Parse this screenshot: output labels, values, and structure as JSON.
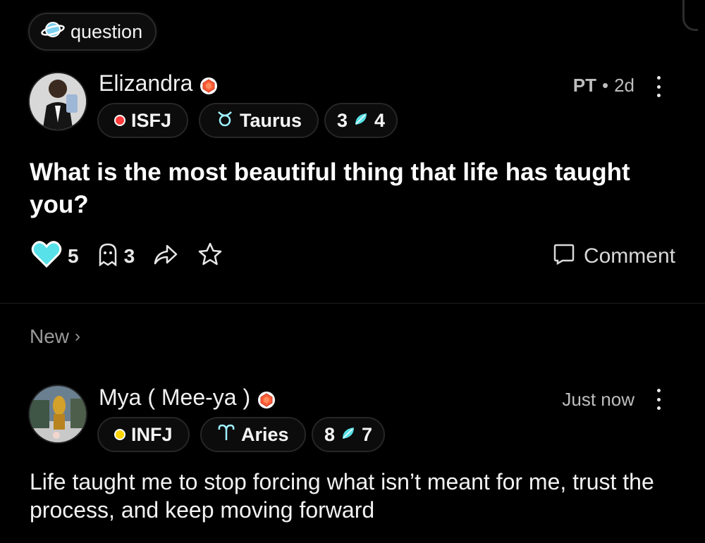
{
  "topic": {
    "label": "question",
    "icon": "planet-icon"
  },
  "post": {
    "author": {
      "name": "Elizandra",
      "mbti": "ISFJ",
      "mbti_color": "#ff3b3b",
      "zodiac": "Taurus",
      "zodiac_icon": "taurus-icon",
      "level_left": "3",
      "level_right": "4"
    },
    "meta": {
      "tag": "PT",
      "separator": "•",
      "time": "2d"
    },
    "title": "What is the most beautiful thing that life has taught you?",
    "likes": "5",
    "comments": "3",
    "comment_button": "Comment"
  },
  "section": {
    "label": "New",
    "chevron": "›"
  },
  "reply": {
    "author": {
      "name": "Mya ( Mee-ya )",
      "mbti": "INFJ",
      "mbti_color": "#ffd400",
      "zodiac": "Aries",
      "zodiac_icon": "aries-icon",
      "level_left": "8",
      "level_right": "7"
    },
    "time": "Just now",
    "text": "Life taught me to stop forcing what isn’t meant for me, trust the process, and keep moving forward"
  },
  "colors": {
    "accent": "#58e1e8",
    "background": "#000000",
    "gem": "#ff5a36"
  }
}
